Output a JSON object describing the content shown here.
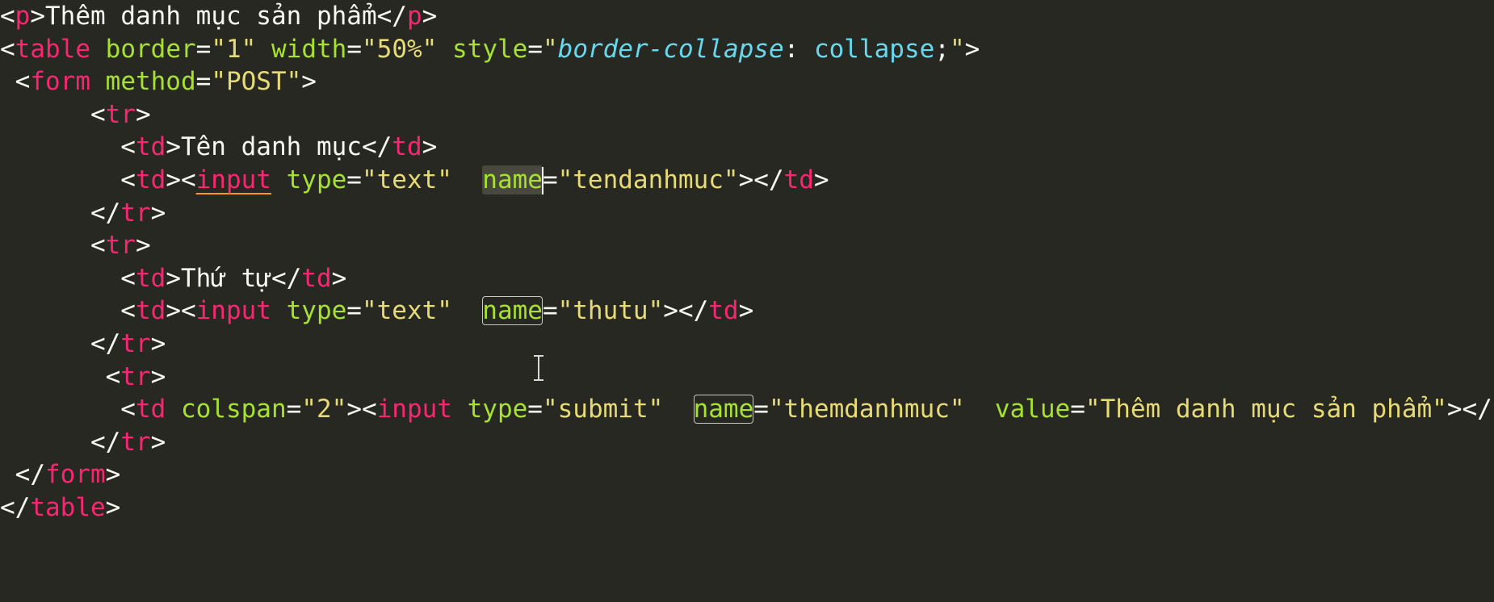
{
  "editor": {
    "theme_colors": {
      "background": "#272822",
      "tag": "#f92672",
      "attribute": "#a6e22e",
      "string": "#e6db74",
      "css": "#66d9ef",
      "text": "#f8f8f2"
    },
    "lines": {
      "l1": {
        "p_open": "p",
        "text": "Thêm danh mục sản phẩm",
        "p_close": "p"
      },
      "l2": {
        "tag": "table",
        "attr1": "border",
        "val1": "\"1\"",
        "attr2": "width",
        "val2": "\"50%\"",
        "attr3": "style",
        "css_prop": "border-collapse",
        "css_val": "collapse"
      },
      "l3": {
        "tag": "form",
        "attr": "method",
        "val": "\"POST\""
      },
      "l4": {
        "tag": "tr"
      },
      "l5": {
        "td": "td",
        "text": "Tên danh mục"
      },
      "l6": {
        "td": "td",
        "input": "input",
        "attr1": "type",
        "val1": "\"text\"",
        "attr2": "name",
        "val2": "\"tendanhmuc\""
      },
      "l7": {
        "tag": "tr"
      },
      "l8": {
        "tag": "tr"
      },
      "l9": {
        "td": "td",
        "text": "Thứ tự"
      },
      "l10": {
        "td": "td",
        "input": "input",
        "attr1": "type",
        "val1": "\"text\"",
        "attr2": "name",
        "val2": "\"thutu\""
      },
      "l11": {
        "tag": "tr"
      },
      "l12": {
        "tag": "tr"
      },
      "l13": {
        "td": "td",
        "attr0": "colspan",
        "val0": "\"2\"",
        "input": "input",
        "attr1": "type",
        "val1": "\"submit\"",
        "attr2": "name",
        "val2": "\"themdanhmuc\"",
        "attr3": "value",
        "val3": "\"Thêm danh mục sản phẩm\""
      },
      "l14": {
        "tag": "tr"
      },
      "l15": {
        "tag": "form"
      },
      "l16": {
        "tag": "table"
      }
    }
  }
}
